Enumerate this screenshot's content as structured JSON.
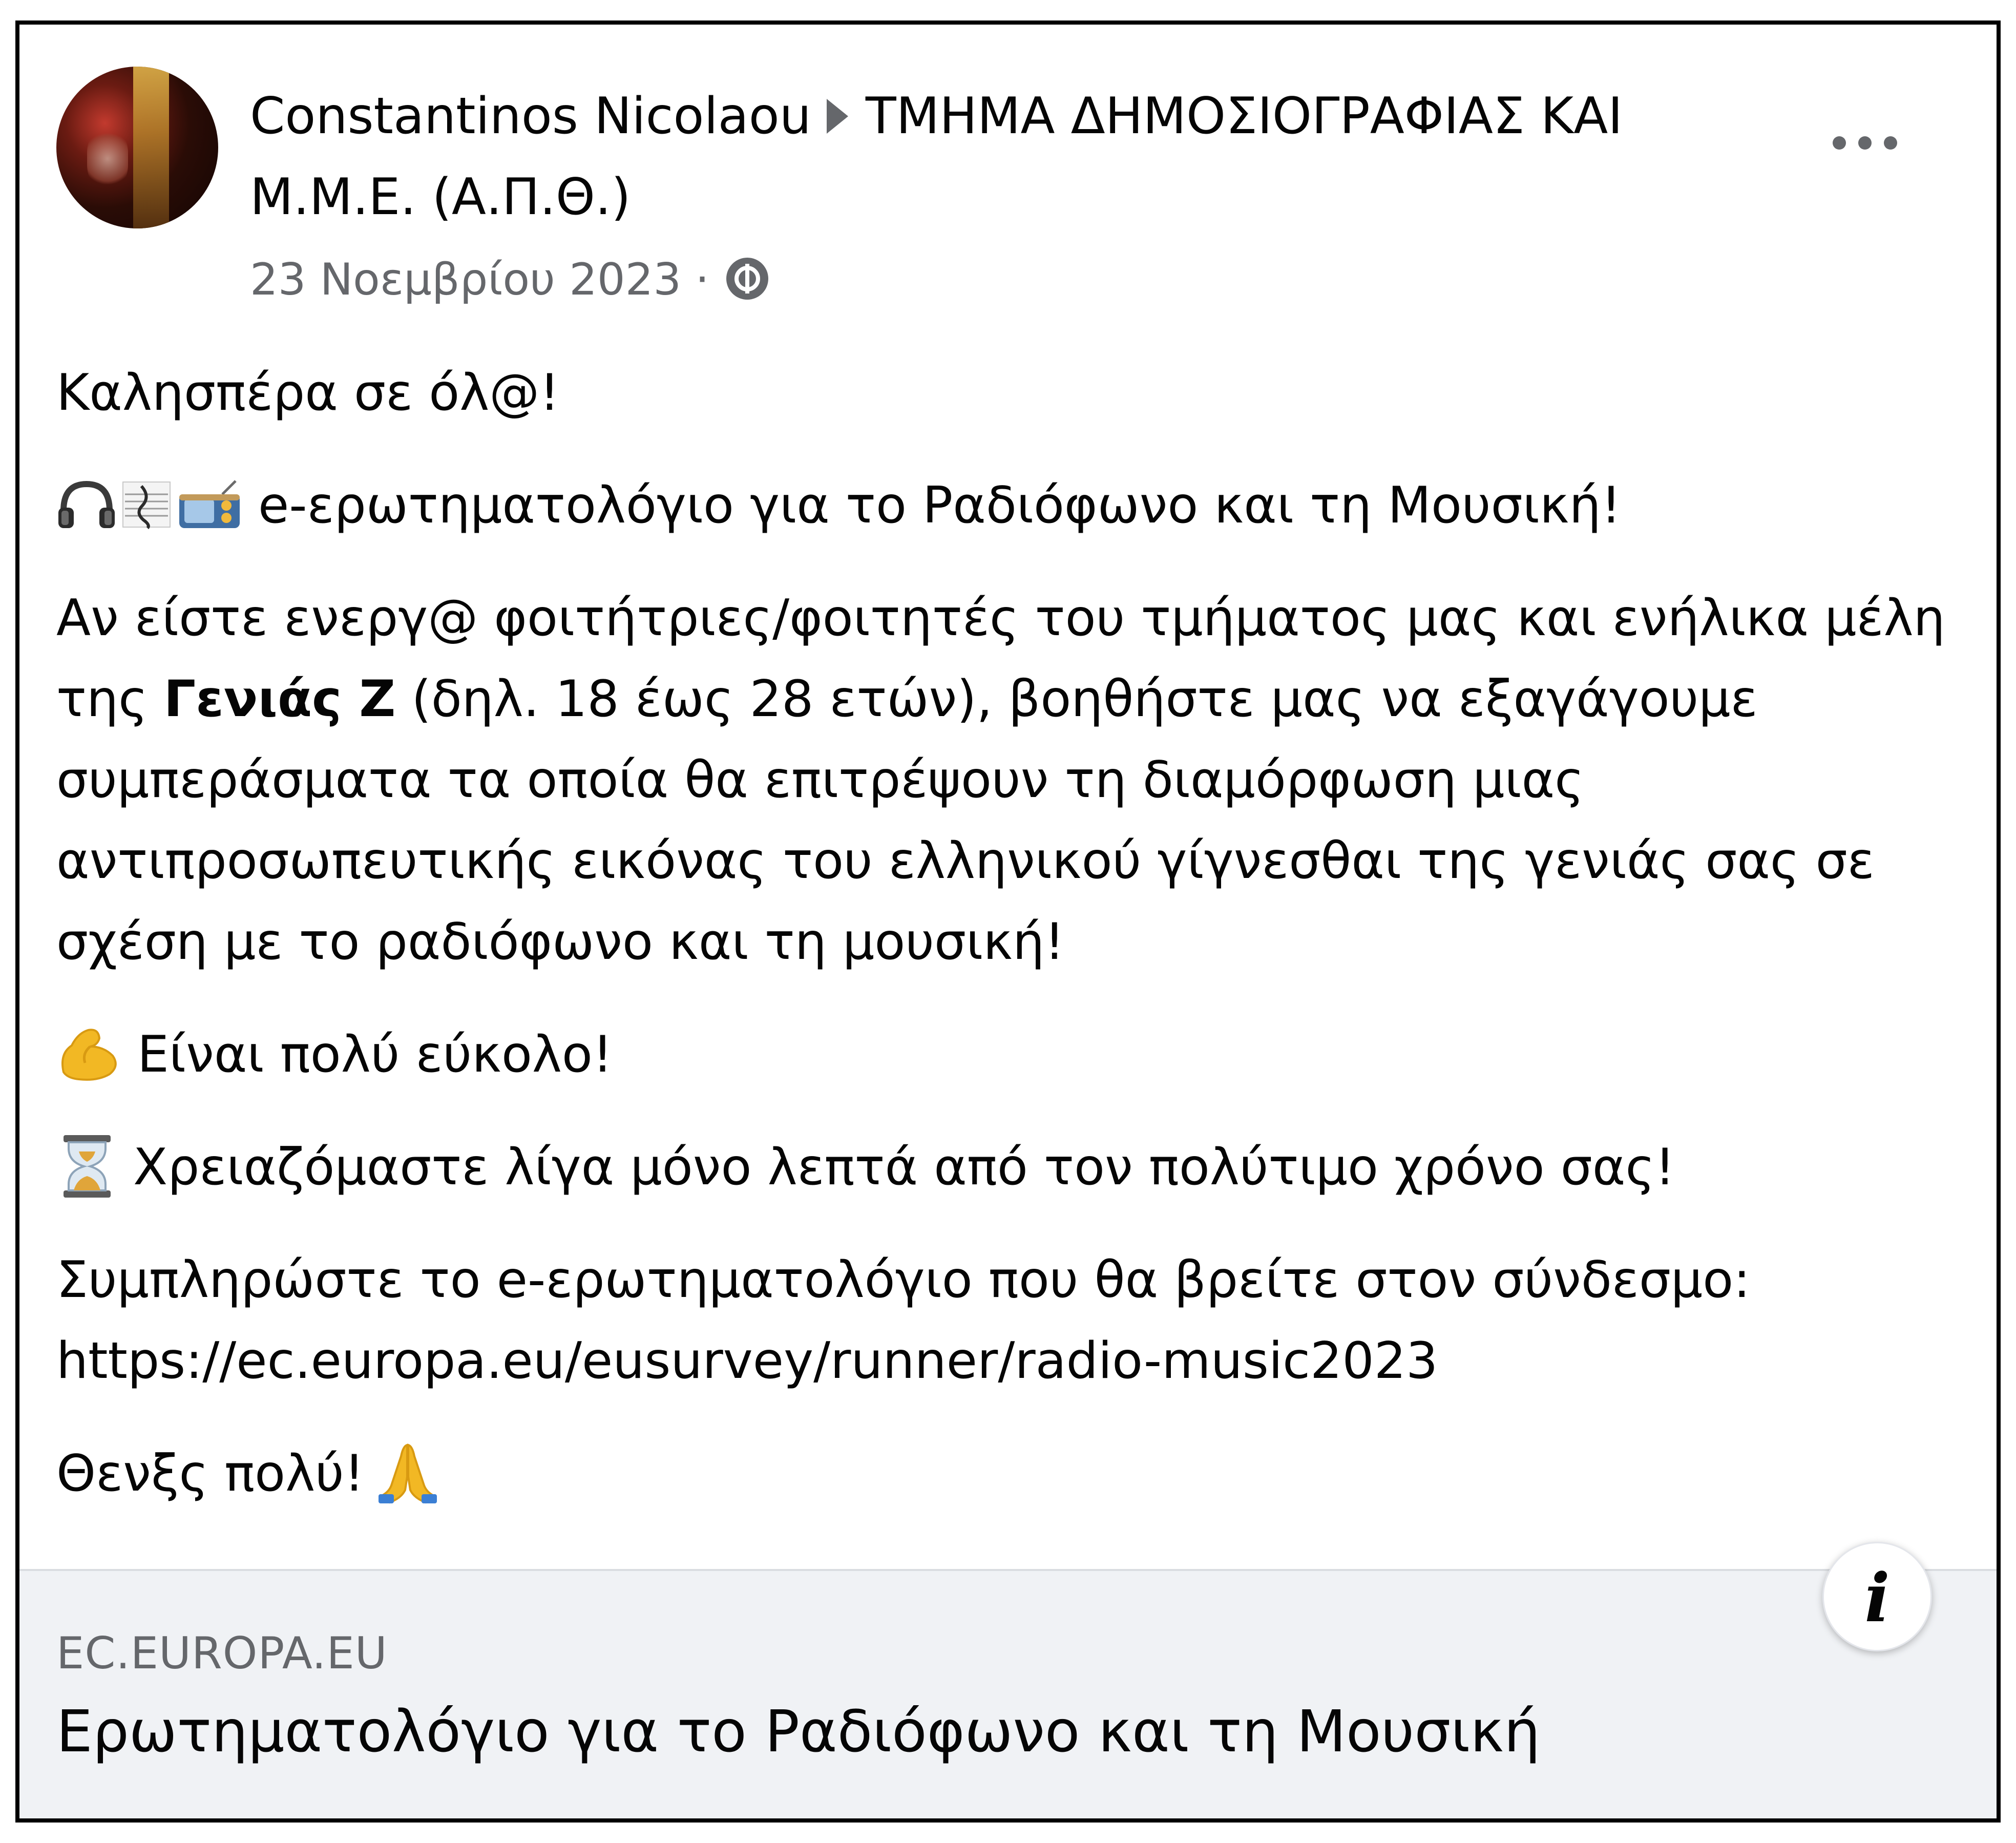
{
  "post": {
    "author": "Constantinos Nicolaou",
    "group": "ΤΜΗΜΑ ΔΗΜΟΣΙΟΓΡΑΦΙΑΣ ΚΑΙ Μ.Μ.Ε. (Α.Π.Θ.)",
    "date": "23 Νοεμβρίου 2023",
    "separator": "·",
    "audience_icon": "group-audience-icon",
    "more_icon": "more-options-icon"
  },
  "content": {
    "greeting": "Καλησπέρα σε όλ@!",
    "survey_line": "e-ερωτηματολόγιο για το Ραδιόφωνο και τη Μουσική!",
    "intro_part1": "Αν είστε ενεργ@ φοιτήτριες/φοιτητές του τμήματος μας και ενήλικα μέλη της ",
    "intro_bold": "Γενιάς Ζ",
    "intro_part2": " (δηλ. 18 έως 28 ετών), βοηθήστε μας να εξαγάγουμε συμπεράσματα τα οποία θα επιτρέψουν τη διαμόρφωση μιας αντιπροσωπευτικής εικόνας του ελληνικού γίγνεσθαι της γενιάς σας σε σχέση με το ραδιόφωνο και τη μουσική!",
    "easy_line": "Είναι πολύ εύκολο!",
    "time_line": "Χρειαζόμαστε λίγα μόνο λεπτά από τον πολύτιμο χρόνο σας!",
    "link_intro": "Συμπληρώστε το e-ερωτηματολόγιο που θα βρείτε στον σύνδεσμο:",
    "link_url": "https://ec.europa.eu/eusurvey/runner/radio-music2023",
    "thanks": "Θενξς πολύ!"
  },
  "link_preview": {
    "domain": "EC.EUROPA.EU",
    "title": "Ερωτηματολόγιο για το Ραδιόφωνο και τη Μουσική",
    "info_glyph": "i"
  },
  "colors": {
    "text": "#050505",
    "secondary": "#65676b",
    "preview_bg": "#f0f2f5"
  }
}
